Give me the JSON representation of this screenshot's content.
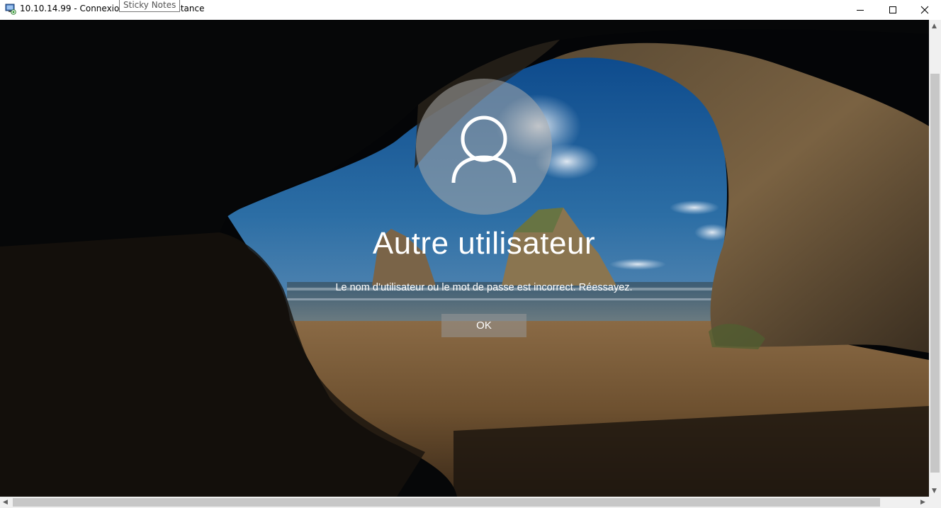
{
  "window": {
    "title": "10.10.14.99 - Connexion Bureau à distance",
    "icon": "remote-desktop-icon",
    "tooltip": "Sticky Notes",
    "controls": [
      "minimize-icon",
      "maximize-icon",
      "close-icon"
    ]
  },
  "lockscreen": {
    "avatar_icon": "user-icon",
    "username": "Autre utilisateur",
    "message": "Le nom d’utilisateur ou le mot de passe est incorrect. Réessayez.",
    "ok_label": "OK"
  },
  "scrollbars": {
    "up_arrow": "▲",
    "down_arrow": "▼",
    "left_arrow": "◀",
    "right_arrow": "▶"
  }
}
